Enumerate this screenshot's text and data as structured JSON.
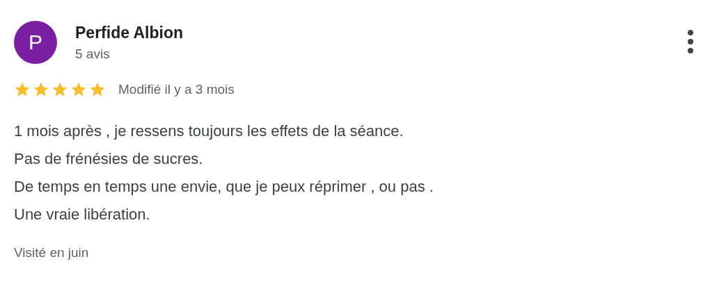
{
  "review": {
    "author": {
      "initial": "P",
      "name": "Perfide Albion",
      "reviews_count": "5 avis",
      "color": "#7b1fa2"
    },
    "stars": 5,
    "date": "Modifié il y a 3 mois",
    "lines": [
      "1 mois après , je ressens toujours les effets de la séance.",
      "Pas de frénésies de sucres.",
      "De temps en temps une envie, que je peux réprimer , ou pas .",
      "Une vraie libération."
    ],
    "visit": "Visité en juin"
  }
}
